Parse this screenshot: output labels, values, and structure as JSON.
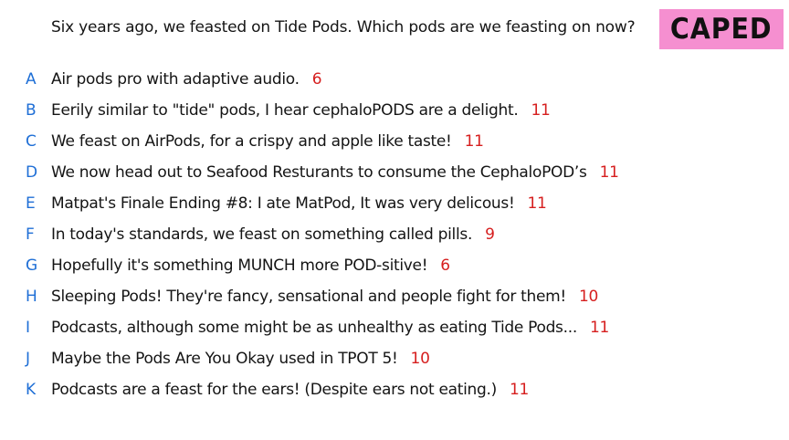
{
  "question": "Six years ago, we feasted on Tide Pods. Which pods are we feasting on now?",
  "brand_label": "CAPED",
  "colors": {
    "brand_bg": "#f58fd0",
    "letter": "#1f6fd6",
    "count": "#d61f1f",
    "text": "#141414"
  },
  "answers": [
    {
      "letter": "A",
      "text": "Air pods pro with adaptive audio.",
      "count": "6"
    },
    {
      "letter": "B",
      "text": "Eerily similar to \"tide\" pods, I hear cephaloPODS are a delight.",
      "count": "11"
    },
    {
      "letter": "C",
      "text": "We feast on AirPods, for a crispy and apple like taste!",
      "count": "11"
    },
    {
      "letter": "D",
      "text": "We now head out to Seafood Resturants to consume the CephaloPOD’s",
      "count": "11"
    },
    {
      "letter": "E",
      "text": "Matpat's Finale Ending #8: I ate MatPod, It was very delicous!",
      "count": "11"
    },
    {
      "letter": "F",
      "text": "In today's standards, we feast on something called pills.",
      "count": "9"
    },
    {
      "letter": "G",
      "text": "Hopefully it's something MUNCH more POD-sitive!",
      "count": "6"
    },
    {
      "letter": "H",
      "text": "Sleeping Pods! They're fancy, sensational and people fight for them!",
      "count": "10"
    },
    {
      "letter": "I",
      "text": "Podcasts, although some might be as unhealthy as eating Tide Pods...",
      "count": "11"
    },
    {
      "letter": "J",
      "text": "Maybe the Pods Are You Okay used in TPOT 5!",
      "count": "10"
    },
    {
      "letter": "K",
      "text": "Podcasts are a feast for the ears! (Despite ears not eating.)",
      "count": "11"
    }
  ]
}
